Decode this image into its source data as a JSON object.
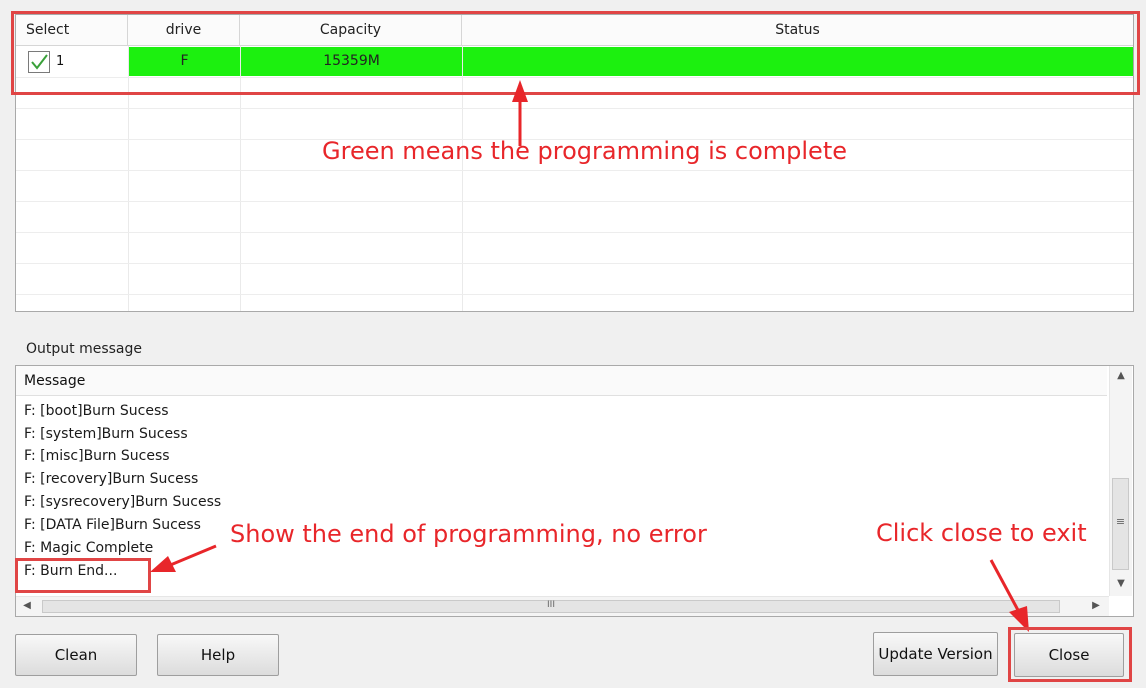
{
  "table": {
    "headers": {
      "select": "Select",
      "drive": "drive",
      "capacity": "Capacity",
      "status": "Status"
    },
    "rows": [
      {
        "select_index": "1",
        "checked": true,
        "drive": "F",
        "capacity": "15359M",
        "status": ""
      }
    ],
    "complete_color": "#1cf00f"
  },
  "annotations": {
    "green_note": "Green means the programming is complete",
    "end_note": "Show the end of programming, no error",
    "close_note": "Click close to exit",
    "highlight_color": "#e8262a"
  },
  "output": {
    "label": "Output message",
    "column_header": "Message",
    "lines": [
      "F: [boot]Burn Sucess",
      "F: [system]Burn Sucess",
      "F: [misc]Burn Sucess",
      "F: [recovery]Burn Sucess",
      "F: [sysrecovery]Burn Sucess",
      "F: [DATA File]Burn Sucess",
      "F: Magic Complete",
      "F: Burn End..."
    ],
    "scroll_grip": "III",
    "scroll_grip_v": "≡"
  },
  "buttons": {
    "clean": "Clean",
    "help": "Help",
    "update_version": "Update Version",
    "close": "Close"
  }
}
